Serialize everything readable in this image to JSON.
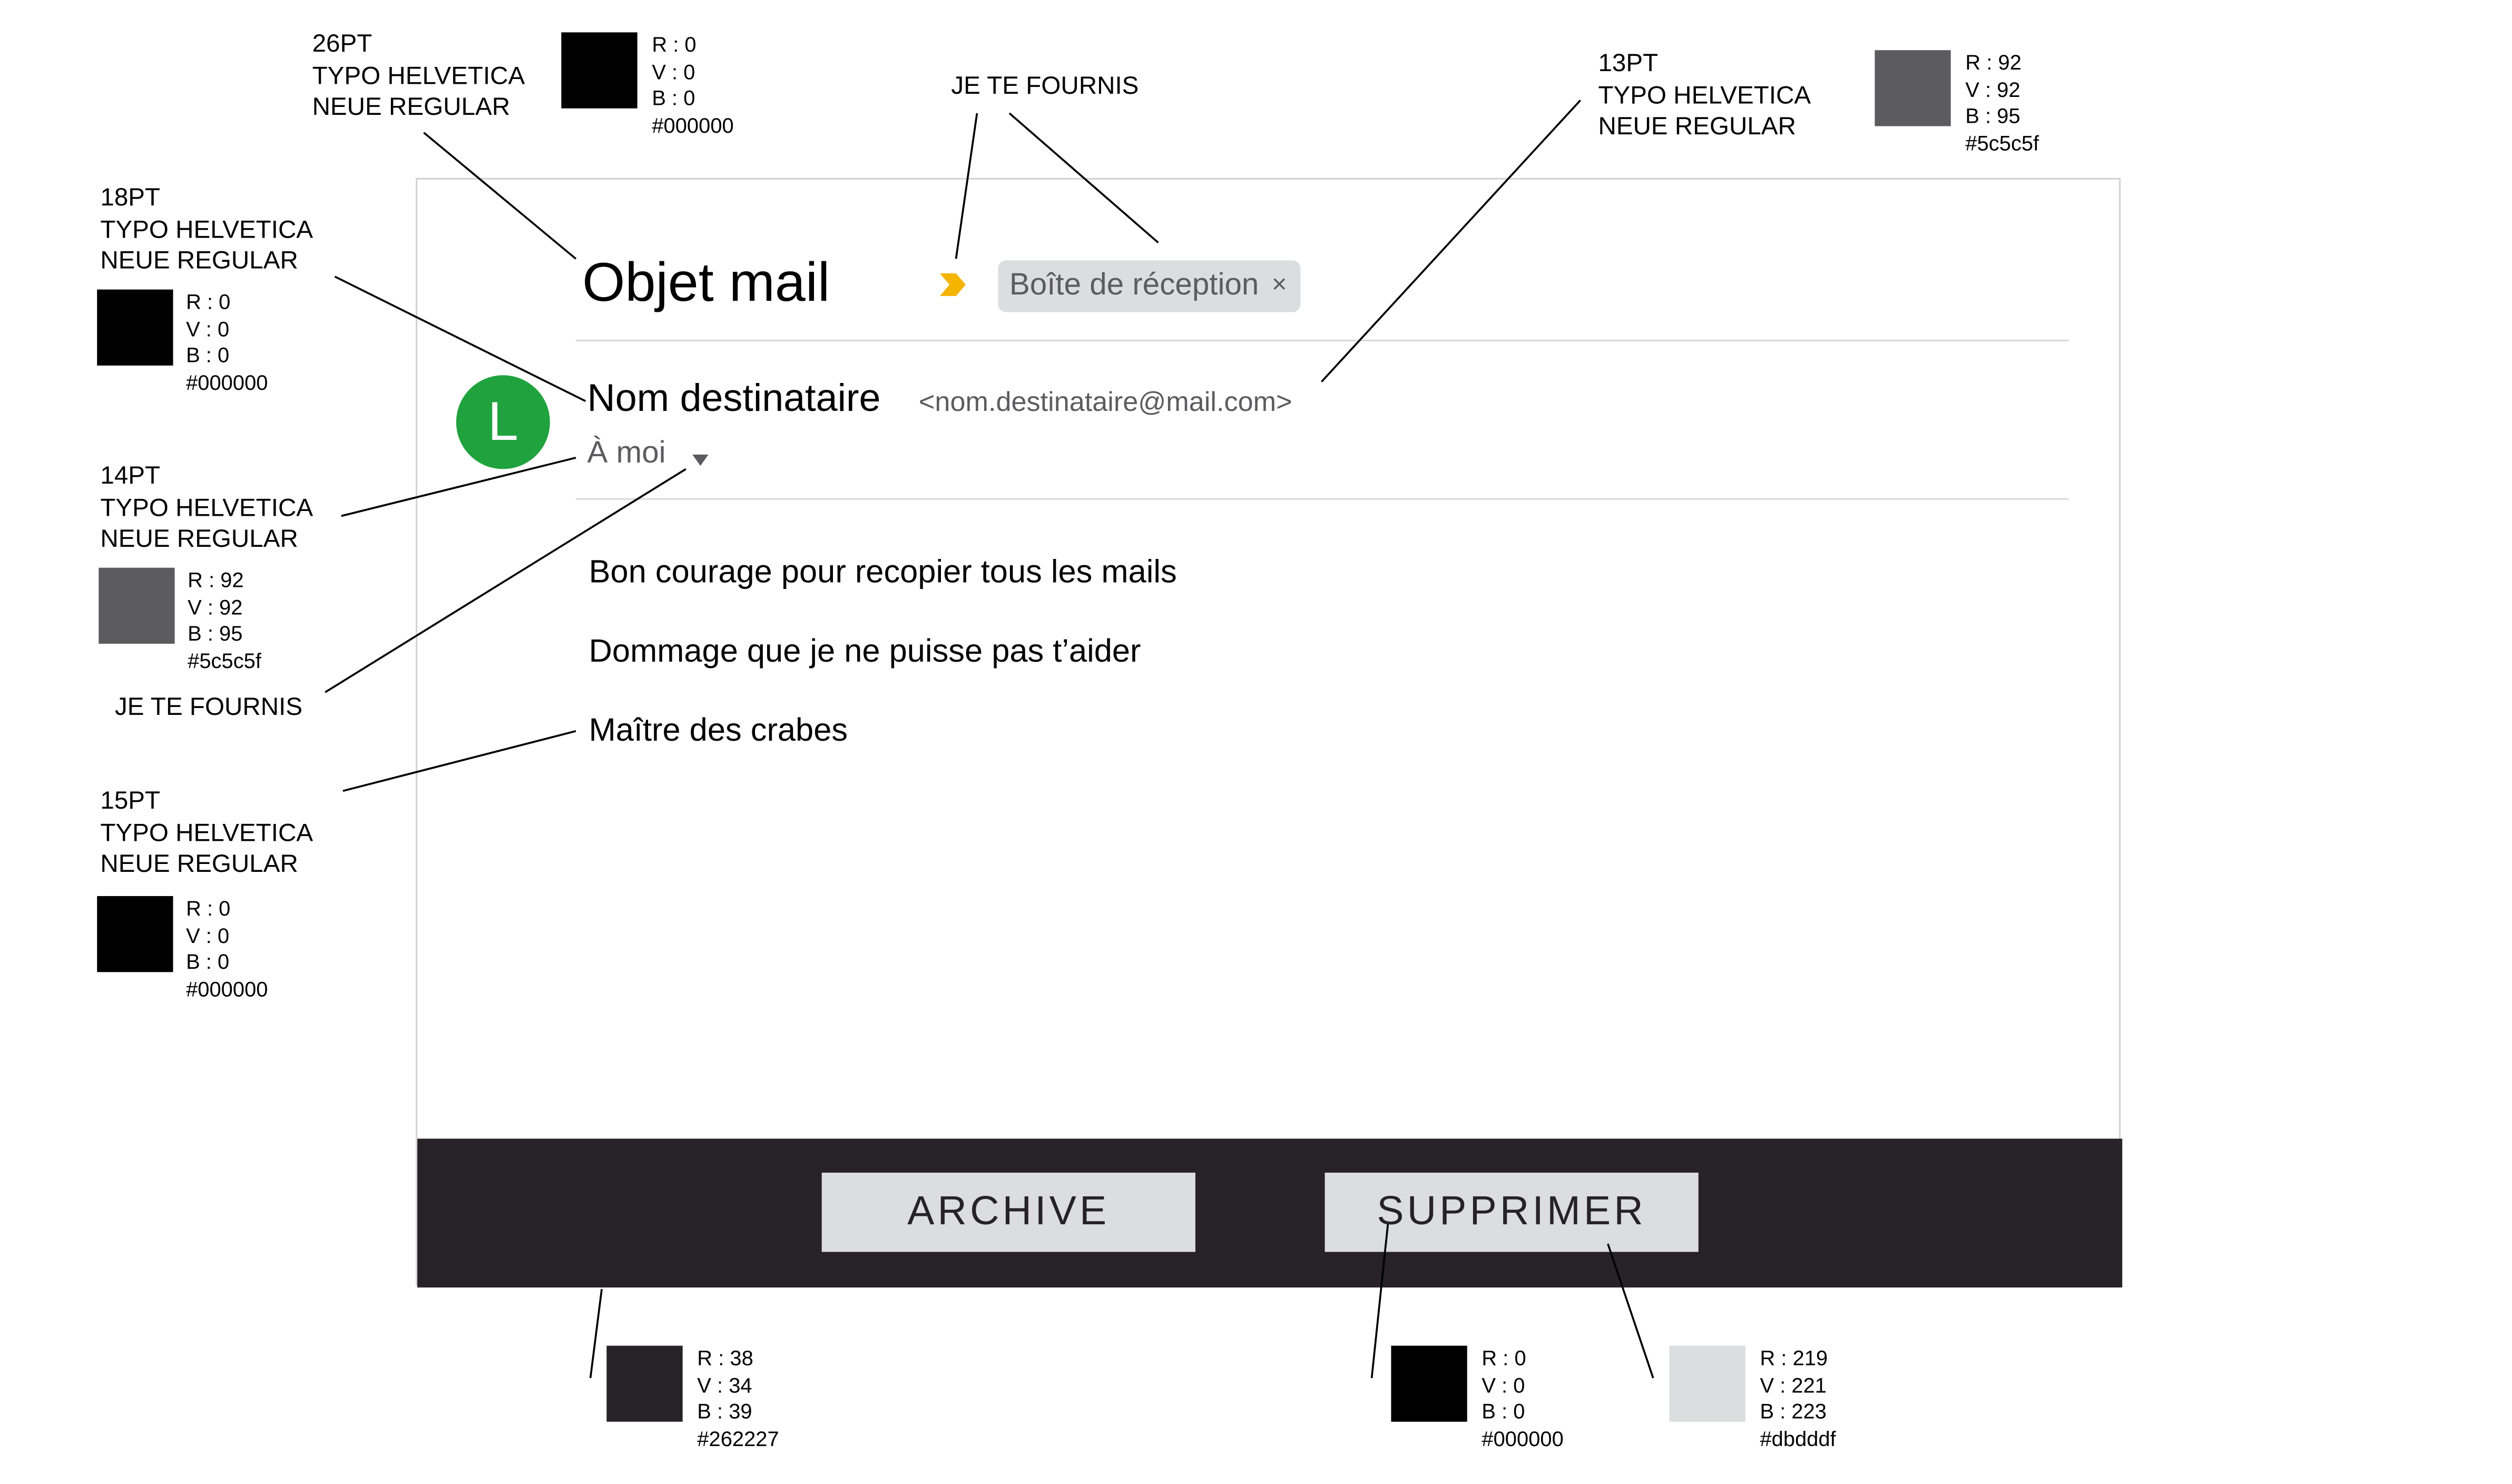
{
  "annotations": {
    "title_spec": [
      "26PT",
      "TYPO HELVETICA",
      "NEUE REGULAR"
    ],
    "sender_spec": [
      "18PT",
      "TYPO HELVETICA",
      "NEUE REGULAR"
    ],
    "recipient_spec": [
      "14PT",
      "TYPO HELVETICA",
      "NEUE REGULAR"
    ],
    "body_spec": [
      "15PT",
      "TYPO HELVETICA",
      "NEUE REGULAR"
    ],
    "email_spec": [
      "13PT",
      "TYPO HELVETICA",
      "NEUE REGULAR"
    ],
    "provided_top": "JE TE FOURNIS",
    "provided_left": "JE TE FOURNIS"
  },
  "swatches": {
    "title_black": {
      "r": "R : 0",
      "v": "V : 0",
      "b": "B : 0",
      "hex": "#000000",
      "color": "#000000"
    },
    "email_gray": {
      "r": "R : 92",
      "v": "V : 92",
      "b": "B : 95",
      "hex": "#5c5c5f",
      "color": "#5c5c5f"
    },
    "sender_black": {
      "r": "R : 0",
      "v": "V : 0",
      "b": "B : 0",
      "hex": "#000000",
      "color": "#000000"
    },
    "recipient_gray": {
      "r": "R : 92",
      "v": "V : 92",
      "b": "B : 95",
      "hex": "#5c5c5f",
      "color": "#5c5c5f"
    },
    "body_black": {
      "r": "R : 0",
      "v": "V : 0",
      "b": "B : 0",
      "hex": "#000000",
      "color": "#000000"
    },
    "footer_dark": {
      "r": "R : 38",
      "v": "V : 34",
      "b": "B : 39",
      "hex": "#262227",
      "color": "#262227"
    },
    "button_text_black": {
      "r": "R : 0",
      "v": "V : 0",
      "b": "B : 0",
      "hex": "#000000",
      "color": "#000000"
    },
    "button_gray": {
      "r": "R : 219",
      "v": "V : 221",
      "b": "B : 223",
      "hex": "#dbdddf",
      "color": "#dbdddf"
    }
  },
  "email": {
    "subject": "Objet mail",
    "label_chip": "Boîte de réception",
    "label_close": "×",
    "avatar_letter": "L",
    "avatar_color": "#20a33e",
    "importance_color": "#f5b400",
    "sender_name": "Nom destinataire",
    "sender_email": "<nom.destinataire@mail.com>",
    "recipient": "À moi",
    "body": [
      "Bon courage pour recopier tous les mails",
      "Dommage que je ne puisse pas t’aider",
      "Maître des crabes"
    ]
  },
  "actions": {
    "archive": "ARCHIVE",
    "delete": "SUPPRIMER"
  }
}
